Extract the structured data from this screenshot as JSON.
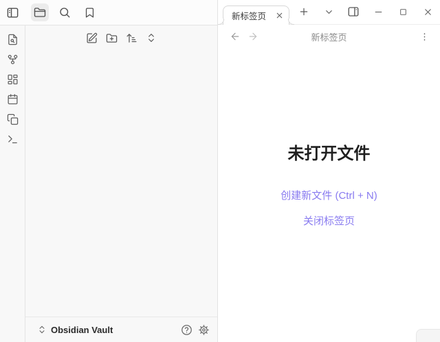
{
  "accent_color": "#897bf0",
  "left_header": {
    "icons": [
      "panel-left-toggle",
      "folder-explorer",
      "search",
      "bookmarks"
    ],
    "active_icon": "folder-explorer"
  },
  "ribbon": {
    "icons": [
      "file-search",
      "graph-view",
      "canvas",
      "daily-note",
      "templates",
      "command-palette"
    ]
  },
  "sidebar": {
    "toolbar_icons": [
      "new-note",
      "new-folder",
      "sort-order",
      "collapse-all"
    ],
    "vault_name": "Obsidian Vault",
    "vault_icons": [
      "vault-switcher-chevrons",
      "help",
      "settings"
    ]
  },
  "tabbar": {
    "tabs": [
      {
        "label": "新标签页",
        "active": true
      }
    ],
    "action_icons": [
      "new-tab",
      "tab-list-dropdown",
      "panel-right-toggle"
    ],
    "window_controls": [
      "minimize",
      "maximize",
      "close"
    ]
  },
  "header": {
    "title": "新标签页",
    "icons": [
      "back",
      "forward",
      "more-options"
    ]
  },
  "empty_state": {
    "heading": "未打开文件",
    "create_link": "创建新文件 (Ctrl + N)",
    "close_link": "关闭标签页"
  }
}
